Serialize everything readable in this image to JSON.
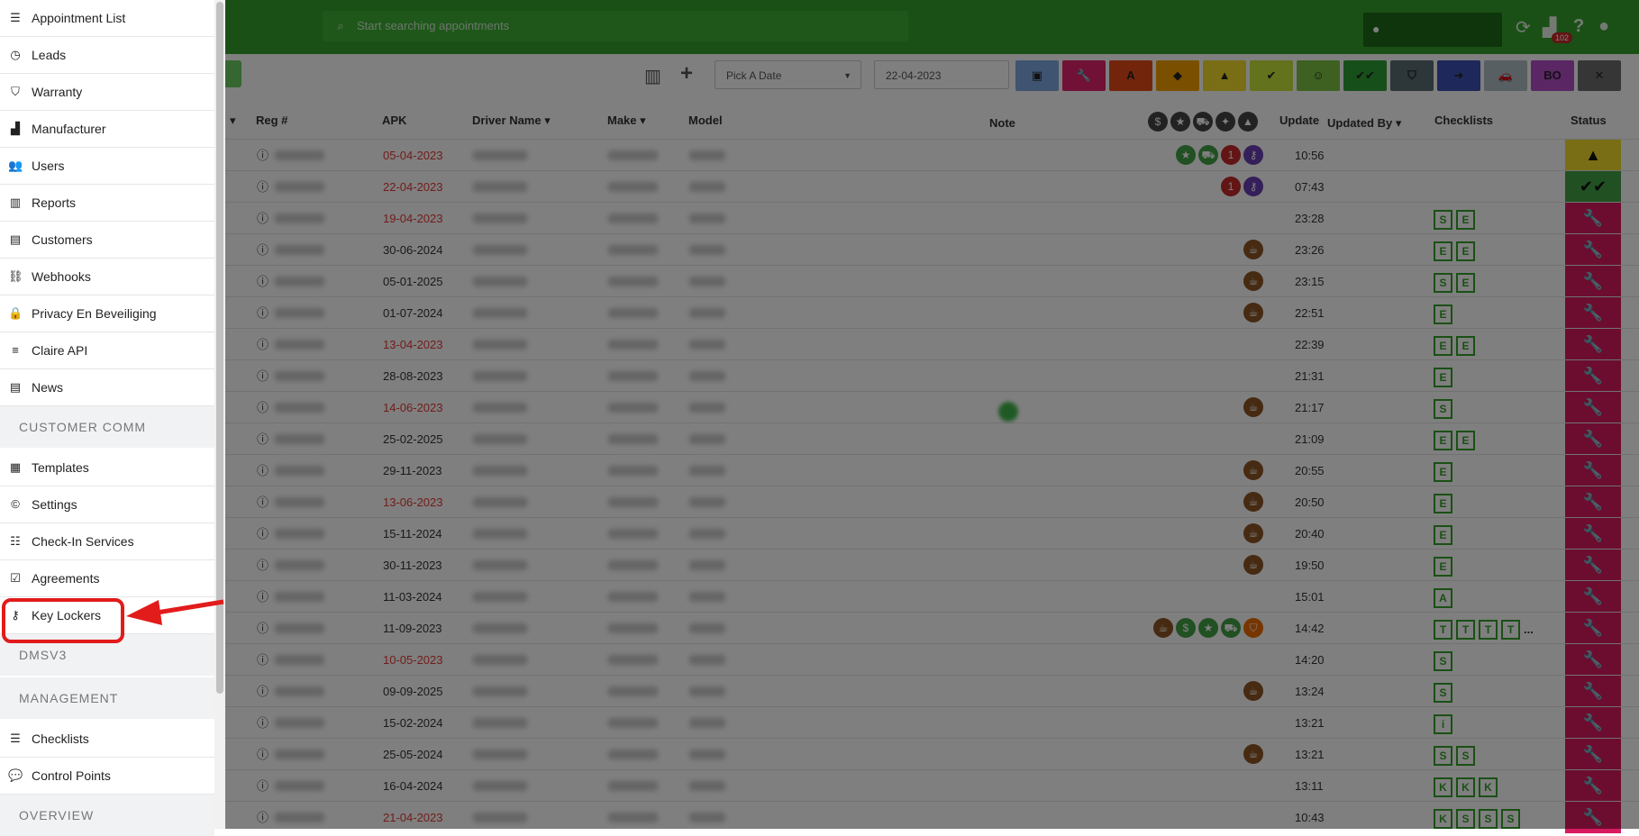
{
  "topbar": {
    "search_placeholder": "Start searching appointments",
    "badge_count": "102",
    "icons": [
      "map-marker-icon",
      "refresh-icon",
      "factory-icon",
      "question-icon",
      "user-icon"
    ]
  },
  "toolbar": {
    "date_placeholder": "Pick A Date",
    "date_value": "22-04-2023",
    "filter_buttons": [
      {
        "name": "calendar",
        "color": "#7fa9e0",
        "label": ""
      },
      {
        "name": "wrench",
        "color": "#e0226b",
        "label": ""
      },
      {
        "name": "font",
        "color": "#e64a19",
        "label": ""
      },
      {
        "name": "tag",
        "color": "#f5a000",
        "label": ""
      },
      {
        "name": "warning",
        "color": "#f2dc2c",
        "label": ""
      },
      {
        "name": "user-check",
        "color": "#c6e53b",
        "label": ""
      },
      {
        "name": "smile",
        "color": "#7cc242",
        "label": ""
      },
      {
        "name": "double-check",
        "color": "#2e9e36",
        "label": ""
      },
      {
        "name": "shield",
        "color": "#5a6f74",
        "label": ""
      },
      {
        "name": "sign-out",
        "color": "#3f51b5",
        "label": ""
      },
      {
        "name": "car",
        "color": "#b0bec5",
        "label": ""
      },
      {
        "name": "bo",
        "color": "#b44ec9",
        "label": "BO"
      },
      {
        "name": "close",
        "color": "#6d6d6d",
        "label": ""
      }
    ]
  },
  "table": {
    "headers": {
      "reg": "Reg #",
      "apk": "APK",
      "driver": "Driver Name",
      "make": "Make",
      "model": "Model",
      "note": "Note",
      "update": "Update",
      "updated_by": "Updated By",
      "checklists": "Checklists",
      "status": "Status"
    },
    "rows": [
      {
        "apk": "05-04-2023",
        "red": true,
        "upd": "10:56",
        "icons": [
          "star",
          "cart",
          "1",
          "key"
        ],
        "cl": [],
        "status": "warning"
      },
      {
        "apk": "22-04-2023",
        "red": true,
        "upd": "07:43",
        "icons": [
          "1",
          "key"
        ],
        "cl": [],
        "status": "check"
      },
      {
        "apk": "19-04-2023",
        "red": true,
        "upd": "23:28",
        "icons": [],
        "cl": [
          "S",
          "E"
        ],
        "status": "wrench"
      },
      {
        "apk": "30-06-2024",
        "red": false,
        "upd": "23:26",
        "icons": [
          "cup"
        ],
        "cl": [
          "E",
          "E"
        ],
        "status": "wrench"
      },
      {
        "apk": "05-01-2025",
        "red": false,
        "upd": "23:15",
        "icons": [
          "cup"
        ],
        "cl": [
          "S",
          "E"
        ],
        "status": "wrench"
      },
      {
        "apk": "01-07-2024",
        "red": false,
        "upd": "22:51",
        "icons": [
          "cup"
        ],
        "cl": [
          "E"
        ],
        "status": "wrench"
      },
      {
        "apk": "13-04-2023",
        "red": true,
        "upd": "22:39",
        "icons": [],
        "cl": [
          "E",
          "E"
        ],
        "status": "wrench"
      },
      {
        "apk": "28-08-2023",
        "red": false,
        "upd": "21:31",
        "icons": [],
        "cl": [
          "E"
        ],
        "status": "wrench"
      },
      {
        "apk": "14-06-2023",
        "red": true,
        "upd": "21:17",
        "icons": [
          "cup"
        ],
        "cl": [
          "S"
        ],
        "status": "wrench"
      },
      {
        "apk": "25-02-2025",
        "red": false,
        "upd": "21:09",
        "icons": [],
        "cl": [
          "E",
          "E"
        ],
        "status": "wrench"
      },
      {
        "apk": "29-11-2023",
        "red": false,
        "upd": "20:55",
        "icons": [
          "cup"
        ],
        "cl": [
          "E"
        ],
        "status": "wrench"
      },
      {
        "apk": "13-06-2023",
        "red": true,
        "upd": "20:50",
        "icons": [
          "cup"
        ],
        "cl": [
          "E"
        ],
        "status": "wrench"
      },
      {
        "apk": "15-11-2024",
        "red": false,
        "upd": "20:40",
        "icons": [
          "cup"
        ],
        "cl": [
          "E"
        ],
        "status": "wrench"
      },
      {
        "apk": "30-11-2023",
        "red": false,
        "upd": "19:50",
        "icons": [
          "cup"
        ],
        "cl": [
          "E"
        ],
        "status": "wrench"
      },
      {
        "apk": "11-03-2024",
        "red": false,
        "upd": "15:01",
        "icons": [],
        "cl": [
          "A"
        ],
        "status": "wrench"
      },
      {
        "apk": "11-09-2023",
        "red": false,
        "upd": "14:42",
        "icons": [
          "cup",
          "dollar",
          "star",
          "cart",
          "shield"
        ],
        "cl": [
          "T",
          "T",
          "T",
          "T"
        ],
        "more": "...",
        "status": "wrench"
      },
      {
        "apk": "10-05-2023",
        "red": true,
        "upd": "14:20",
        "icons": [],
        "cl": [
          "S"
        ],
        "status": "wrench"
      },
      {
        "apk": "09-09-2025",
        "red": false,
        "upd": "13:24",
        "icons": [
          "cup"
        ],
        "cl": [
          "S"
        ],
        "status": "wrench"
      },
      {
        "apk": "15-02-2024",
        "red": false,
        "upd": "13:21",
        "icons": [],
        "cl": [
          "i"
        ],
        "status": "wrench"
      },
      {
        "apk": "25-05-2024",
        "red": false,
        "upd": "13:21",
        "icons": [
          "cup"
        ],
        "cl": [
          "S",
          "S"
        ],
        "status": "wrench"
      },
      {
        "apk": "16-04-2024",
        "red": false,
        "upd": "13:11",
        "icons": [],
        "cl": [
          "K",
          "K",
          "K"
        ],
        "status": "wrench"
      },
      {
        "apk": "21-04-2023",
        "red": true,
        "upd": "10:43",
        "icons": [],
        "cl": [
          "K",
          "S",
          "S",
          "S"
        ],
        "status": "wrench"
      }
    ]
  },
  "sidebar": {
    "items": [
      {
        "id": "appointment-list",
        "label": "Appointment List",
        "icon": "list-icon",
        "glyph": "☰"
      },
      {
        "id": "leads",
        "label": "Leads",
        "icon": "clock-icon",
        "glyph": "◷"
      },
      {
        "id": "warranty",
        "label": "Warranty",
        "icon": "shield-icon",
        "glyph": "⛉"
      },
      {
        "id": "manufacturer",
        "label": "Manufacturer",
        "icon": "factory-icon",
        "glyph": "▟"
      },
      {
        "id": "users",
        "label": "Users",
        "icon": "users-icon",
        "glyph": "👥"
      },
      {
        "id": "reports",
        "label": "Reports",
        "icon": "bar-chart-icon",
        "glyph": "▥"
      },
      {
        "id": "customers",
        "label": "Customers",
        "icon": "id-card-icon",
        "glyph": "▤"
      },
      {
        "id": "webhooks",
        "label": "Webhooks",
        "icon": "link-icon",
        "glyph": "⛓"
      },
      {
        "id": "privacy",
        "label": "Privacy En Beveiliging",
        "icon": "lock-icon",
        "glyph": "🔒"
      },
      {
        "id": "claire-api",
        "label": "Claire API",
        "icon": "server-icon",
        "glyph": "≡"
      },
      {
        "id": "news",
        "label": "News",
        "icon": "newspaper-icon",
        "glyph": "▤"
      }
    ],
    "section_customer_comm": "CUSTOMER COMM",
    "comm_items": [
      {
        "id": "templates",
        "label": "Templates",
        "icon": "film-icon",
        "glyph": "▦"
      },
      {
        "id": "settings",
        "label": "Settings",
        "icon": "copyright-icon",
        "glyph": "©"
      },
      {
        "id": "check-in-services",
        "label": "Check-In Services",
        "icon": "table-list-icon",
        "glyph": "☷"
      },
      {
        "id": "agreements",
        "label": "Agreements",
        "icon": "checkbox-icon",
        "glyph": "☑"
      },
      {
        "id": "key-lockers",
        "label": "Key Lockers",
        "icon": "key-icon",
        "glyph": "⚷"
      }
    ],
    "section_dmsv3": "DMSV3",
    "section_management": "MANAGEMENT",
    "mgmt_items": [
      {
        "id": "checklists",
        "label": "Checklists",
        "icon": "list-icon",
        "glyph": "☰"
      },
      {
        "id": "control-points",
        "label": "Control Points",
        "icon": "comment-icon",
        "glyph": "💬"
      }
    ],
    "section_overview": "OVERVIEW"
  },
  "colors": {
    "brand": "#34a12b",
    "highlight": "#e21b1b",
    "status_red": "#d81b60",
    "status_yellow": "#f2dc2c",
    "status_green": "#43a047"
  }
}
